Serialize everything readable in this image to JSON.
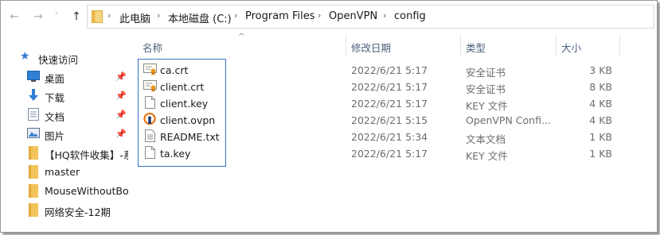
{
  "nav": {
    "back_glyph": "←",
    "forward_glyph": "→",
    "history_glyph": "˅",
    "up_glyph": "↑"
  },
  "breadcrumb": [
    "此电脑",
    "本地磁盘 (C:)",
    "Program Files",
    "OpenVPN",
    "config"
  ],
  "breadcrumb_sep": "›",
  "sidebar": {
    "quick_access": "快速访问",
    "items": [
      {
        "label": "桌面",
        "icon": "desktop-icon",
        "pinned": true
      },
      {
        "label": "下载",
        "icon": "download-icon",
        "pinned": true
      },
      {
        "label": "文档",
        "icon": "documents-icon",
        "pinned": true
      },
      {
        "label": "图片",
        "icon": "pictures-icon",
        "pinned": true
      },
      {
        "label": "【HQ软件收集】-系",
        "icon": "folder-icon",
        "pinned": false
      },
      {
        "label": "master",
        "icon": "folder-icon",
        "pinned": false
      },
      {
        "label": "MouseWithoutBor",
        "icon": "folder-icon",
        "pinned": false
      },
      {
        "label": "网络安全-12期",
        "icon": "folder-icon",
        "pinned": false
      }
    ]
  },
  "columns": {
    "name": "名称",
    "date": "修改日期",
    "type": "类型",
    "size": "大小",
    "sort_glyph": "^"
  },
  "files": [
    {
      "name": "ca.crt",
      "date": "2022/6/21 5:17",
      "type": "安全证书",
      "size": "3 KB",
      "icon": "certificate-icon"
    },
    {
      "name": "client.crt",
      "date": "2022/6/21 5:17",
      "type": "安全证书",
      "size": "8 KB",
      "icon": "certificate-icon"
    },
    {
      "name": "client.key",
      "date": "2022/6/21 5:17",
      "type": "KEY 文件",
      "size": "4 KB",
      "icon": "file-icon"
    },
    {
      "name": "client.ovpn",
      "date": "2022/6/21 5:15",
      "type": "OpenVPN Confi...",
      "size": "4 KB",
      "icon": "openvpn-icon"
    },
    {
      "name": "README.txt",
      "date": "2022/6/21 5:34",
      "type": "文本文档",
      "size": "1 KB",
      "icon": "text-file-icon"
    },
    {
      "name": "ta.key",
      "date": "2022/6/21 5:17",
      "type": "KEY 文件",
      "size": "1 KB",
      "icon": "file-icon"
    }
  ],
  "colors": {
    "accent": "#3a74c4",
    "folder": "#f2c45a",
    "header_text": "#4c607a"
  }
}
